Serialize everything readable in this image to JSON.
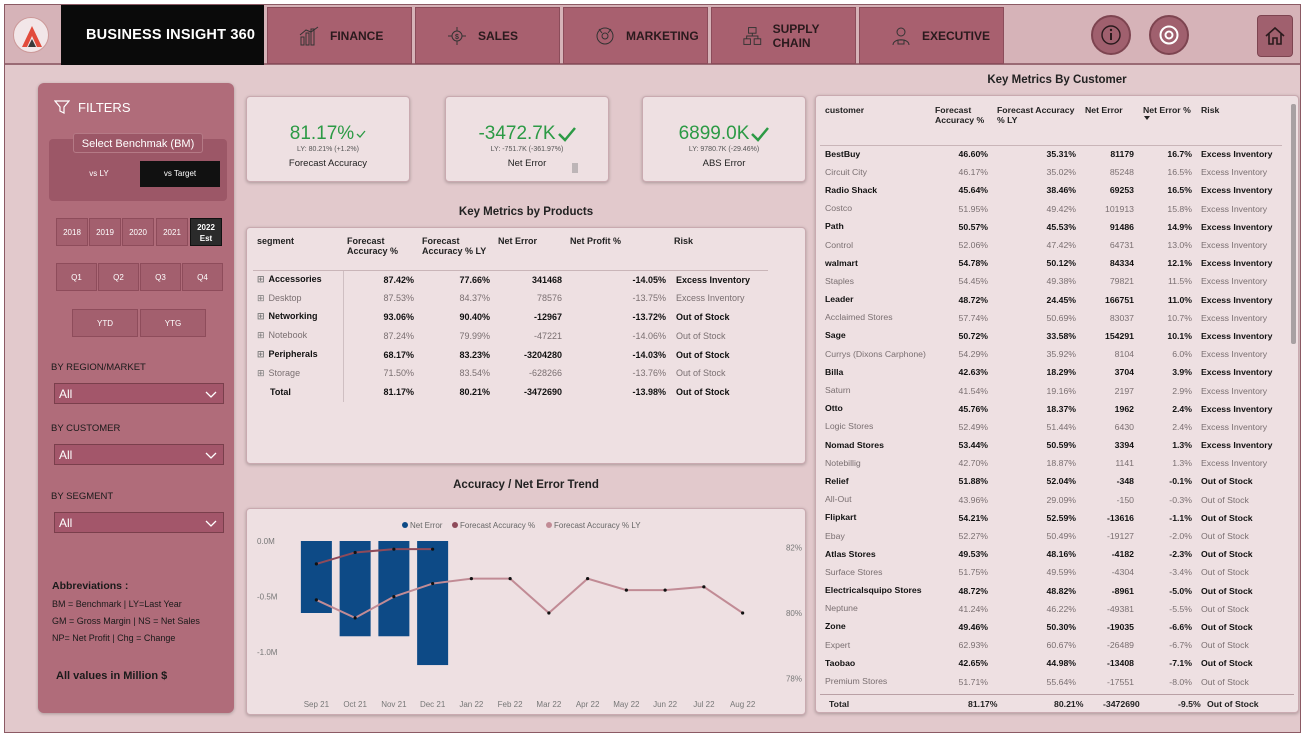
{
  "app": {
    "title": "BUSINESS INSIGHT 360",
    "nav": [
      {
        "label": "FINANCE",
        "icon": "finance-chart-icon"
      },
      {
        "label": "SALES",
        "icon": "sales-icon"
      },
      {
        "label": "MARKETING",
        "icon": "marketing-icon"
      },
      {
        "label": "SUPPLY CHAIN",
        "icon": "supply-chain-icon"
      },
      {
        "label": "EXECUTIVE",
        "icon": "executive-icon"
      }
    ]
  },
  "filters": {
    "title": "FILTERS",
    "benchmark_label": "Select Benchmak (BM)",
    "benchmark_options": [
      "vs LY",
      "vs Target"
    ],
    "benchmark_selected": "vs Target",
    "years": [
      "2018",
      "2019",
      "2020",
      "2021",
      "2022 Est"
    ],
    "year_selected": "2022 Est",
    "quarters": [
      "Q1",
      "Q2",
      "Q3",
      "Q4"
    ],
    "ytd": "YTD",
    "ytg": "YTG",
    "region_label": "BY REGION/MARKET",
    "region_value": "All",
    "customer_label": "BY CUSTOMER",
    "customer_value": "All",
    "segment_label": "BY SEGMENT",
    "segment_value": "All",
    "abbr_title": "Abbreviations :",
    "abbr_lines": [
      "BM = Benchmark | LY=Last Year",
      "GM = Gross Margin | NS = Net Sales",
      "NP= Net Profit | Chg = Change"
    ],
    "all_values": "All values in Million $"
  },
  "kpis": [
    {
      "value": "81.17%",
      "sub": "LY: 80.21% (+1.2%)",
      "label": "Forecast Accuracy",
      "color": "#2c9a45"
    },
    {
      "value": "-3472.7K",
      "sub": "LY: -751.7K (-361.97%)",
      "label": "Net Error",
      "color": "#2c9a45"
    },
    {
      "value": "6899.0K",
      "sub": "LY: 9780.7K (-29.46%)",
      "label": "ABS Error",
      "color": "#2c9a45"
    }
  ],
  "products": {
    "title": "Key Metrics by Products",
    "headers": [
      "segment",
      "Forecast Accuracy %",
      "Forecast Accuracy % LY",
      "Net Error",
      "Net Profit %",
      "Risk"
    ],
    "rows": [
      {
        "segment": "Accessories",
        "fa": "87.42%",
        "faly": "77.66%",
        "ne": "341468",
        "np": "-14.05%",
        "risk": "Excess Inventory",
        "dim": false
      },
      {
        "segment": "Desktop",
        "fa": "87.53%",
        "faly": "84.37%",
        "ne": "78576",
        "np": "-13.75%",
        "risk": "Excess Inventory",
        "dim": true
      },
      {
        "segment": "Networking",
        "fa": "93.06%",
        "faly": "90.40%",
        "ne": "-12967",
        "np": "-13.72%",
        "risk": "Out of Stock",
        "dim": false
      },
      {
        "segment": "Notebook",
        "fa": "87.24%",
        "faly": "79.99%",
        "ne": "-47221",
        "np": "-14.06%",
        "risk": "Out of Stock",
        "dim": true
      },
      {
        "segment": "Peripherals",
        "fa": "68.17%",
        "faly": "83.23%",
        "ne": "-3204280",
        "np": "-14.03%",
        "risk": "Out of Stock",
        "dim": false
      },
      {
        "segment": "Storage",
        "fa": "71.50%",
        "faly": "83.54%",
        "ne": "-628266",
        "np": "-13.76%",
        "risk": "Out of Stock",
        "dim": true
      },
      {
        "segment": "Total",
        "fa": "81.17%",
        "faly": "80.21%",
        "ne": "-3472690",
        "np": "-13.98%",
        "risk": "Out of Stock",
        "dim": false
      }
    ]
  },
  "trend_title": "Accuracy / Net Error Trend",
  "chart_data": {
    "type": "bar",
    "title": "Accuracy / Net Error Trend",
    "categories": [
      "Sep 21",
      "Oct 21",
      "Nov 21",
      "Dec 21",
      "Jan 22",
      "Feb 22",
      "Mar 22",
      "Apr 22",
      "May 22",
      "Jun 22",
      "Jul 22",
      "Aug 22"
    ],
    "y_left_ticks": [
      "0.0M",
      "-0.5M",
      "-1.0M"
    ],
    "y_left_range": [
      -1.3,
      0
    ],
    "y_right_ticks": [
      "82%",
      "80%",
      "78%"
    ],
    "y_right_range": [
      77.8,
      82.2
    ],
    "series": [
      {
        "name": "Net Error",
        "type": "bar",
        "color": "#0d4a86",
        "values": [
          -0.65,
          -0.86,
          -0.86,
          -1.12,
          null,
          null,
          null,
          null,
          null,
          null,
          null,
          null
        ]
      },
      {
        "name": "Forecast Accuracy %",
        "type": "line",
        "color": "#8e4a5a",
        "values": [
          81.5,
          81.85,
          81.95,
          81.95,
          null,
          null,
          null,
          null,
          null,
          null,
          null,
          null
        ]
      },
      {
        "name": "Forecast Accuracy % LY",
        "type": "line",
        "color": "#c18b95",
        "values": [
          80.4,
          79.85,
          80.5,
          80.9,
          81.05,
          81.05,
          80.0,
          81.05,
          80.7,
          80.7,
          80.8,
          80.0
        ]
      }
    ]
  },
  "customers": {
    "title": "Key Metrics By Customer",
    "headers": [
      "customer",
      "Forecast Accuracy %",
      "Forecast Accuracy % LY",
      "Net Error",
      "Net Error %",
      "Risk"
    ],
    "rows": [
      [
        "BestBuy",
        "46.60%",
        "35.31%",
        "81179",
        "16.7%",
        "Excess Inventory"
      ],
      [
        "Circuit City",
        "46.17%",
        "35.02%",
        "85248",
        "16.5%",
        "Excess Inventory"
      ],
      [
        "Radio Shack",
        "45.64%",
        "38.46%",
        "69253",
        "16.5%",
        "Excess Inventory"
      ],
      [
        "Costco",
        "51.95%",
        "49.42%",
        "101913",
        "15.8%",
        "Excess Inventory"
      ],
      [
        "Path",
        "50.57%",
        "45.53%",
        "91486",
        "14.9%",
        "Excess Inventory"
      ],
      [
        "Control",
        "52.06%",
        "47.42%",
        "64731",
        "13.0%",
        "Excess Inventory"
      ],
      [
        "walmart",
        "54.78%",
        "50.12%",
        "84334",
        "12.1%",
        "Excess Inventory"
      ],
      [
        "Staples",
        "54.45%",
        "49.38%",
        "79821",
        "11.5%",
        "Excess Inventory"
      ],
      [
        "Leader",
        "48.72%",
        "24.45%",
        "166751",
        "11.0%",
        "Excess Inventory"
      ],
      [
        "Acclaimed Stores",
        "57.74%",
        "50.69%",
        "83037",
        "10.7%",
        "Excess Inventory"
      ],
      [
        "Sage",
        "50.72%",
        "33.58%",
        "154291",
        "10.1%",
        "Excess Inventory"
      ],
      [
        "Currys (Dixons Carphone)",
        "54.29%",
        "35.92%",
        "8104",
        "6.0%",
        "Excess Inventory"
      ],
      [
        "Billa",
        "42.63%",
        "18.29%",
        "3704",
        "3.9%",
        "Excess Inventory"
      ],
      [
        "Saturn",
        "41.54%",
        "19.16%",
        "2197",
        "2.9%",
        "Excess Inventory"
      ],
      [
        "Otto",
        "45.76%",
        "18.37%",
        "1962",
        "2.4%",
        "Excess Inventory"
      ],
      [
        "Logic Stores",
        "52.49%",
        "51.44%",
        "6430",
        "2.4%",
        "Excess Inventory"
      ],
      [
        "Nomad Stores",
        "53.44%",
        "50.59%",
        "3394",
        "1.3%",
        "Excess Inventory"
      ],
      [
        "Notebillig",
        "42.70%",
        "18.87%",
        "1141",
        "1.3%",
        "Excess Inventory"
      ],
      [
        "Relief",
        "51.88%",
        "52.04%",
        "-348",
        "-0.1%",
        "Out of Stock"
      ],
      [
        "All-Out",
        "43.96%",
        "29.09%",
        "-150",
        "-0.3%",
        "Out of Stock"
      ],
      [
        "Flipkart",
        "54.21%",
        "52.59%",
        "-13616",
        "-1.1%",
        "Out of Stock"
      ],
      [
        "Ebay",
        "52.27%",
        "50.49%",
        "-19127",
        "-2.0%",
        "Out of Stock"
      ],
      [
        "Atlas Stores",
        "49.53%",
        "48.16%",
        "-4182",
        "-2.3%",
        "Out of Stock"
      ],
      [
        "Surface Stores",
        "51.75%",
        "49.59%",
        "-4304",
        "-3.4%",
        "Out of Stock"
      ],
      [
        "Electricalsquipo Stores",
        "48.72%",
        "48.82%",
        "-8961",
        "-5.0%",
        "Out of Stock"
      ],
      [
        "Neptune",
        "41.24%",
        "46.22%",
        "-49381",
        "-5.5%",
        "Out of Stock"
      ],
      [
        "Zone",
        "49.46%",
        "50.30%",
        "-19035",
        "-6.6%",
        "Out of Stock"
      ],
      [
        "Expert",
        "62.93%",
        "60.67%",
        "-26489",
        "-6.7%",
        "Out of Stock"
      ],
      [
        "Taobao",
        "42.65%",
        "44.98%",
        "-13408",
        "-7.1%",
        "Out of Stock"
      ],
      [
        "Premium Stores",
        "51.71%",
        "55.64%",
        "-17551",
        "-8.0%",
        "Out of Stock"
      ]
    ],
    "total": [
      "Total",
      "81.17%",
      "80.21%",
      "-3472690",
      "-9.5%",
      "Out of Stock"
    ]
  }
}
